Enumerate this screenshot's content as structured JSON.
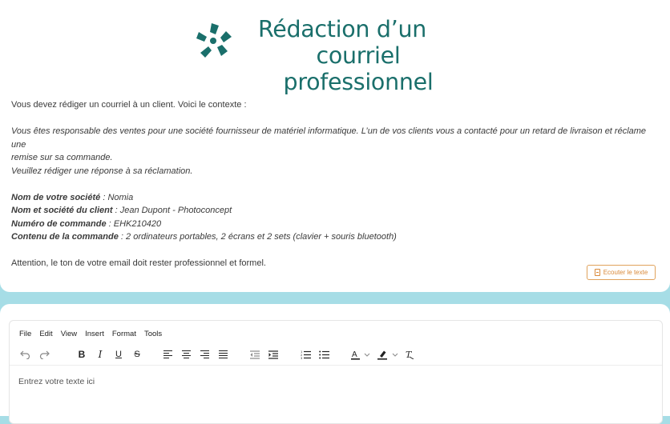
{
  "header": {
    "title_line1": "Rédaction d’un",
    "title_line2": "courriel professionnel",
    "brand_color": "#1a6f6b"
  },
  "instructions": {
    "intro": "Vous devez rédiger un courriel à un client. Voici le contexte :",
    "context_line1": "Vous êtes responsable des ventes pour une société fournisseur de matériel informatique. L’un de vos clients vous a contacté pour un retard de livraison et réclame une",
    "context_line2": "remise sur sa commande.",
    "context_line3": "Veuillez rédiger une réponse à sa réclamation.",
    "facts": [
      {
        "label": "Nom de votre société",
        "value": "Nomia"
      },
      {
        "label": "Nom et société du client",
        "value": "Jean Dupont - Photoconcept"
      },
      {
        "label": "Numéro de commande",
        "value": "EHK210420"
      },
      {
        "label": "Contenu de la commande",
        "value": "2 ordinateurs portables, 2 écrans et 2 sets (clavier + souris bluetooth)"
      }
    ],
    "warning": "Attention, le ton de votre email doit rester professionnel et formel."
  },
  "listen_button": {
    "label": "Ecouter le texte",
    "color": "#d9893a"
  },
  "editor": {
    "menu": [
      "File",
      "Edit",
      "View",
      "Insert",
      "Format",
      "Tools"
    ],
    "toolbar_icons": [
      "undo-icon",
      "redo-icon",
      "bold-icon",
      "italic-icon",
      "underline-icon",
      "strikethrough-icon",
      "align-left-icon",
      "align-center-icon",
      "align-right-icon",
      "align-justify-icon",
      "outdent-icon",
      "indent-icon",
      "numbered-list-icon",
      "bullet-list-icon",
      "text-color-icon",
      "highlight-color-icon",
      "clear-format-icon"
    ],
    "placeholder": "Entrez votre texte ici"
  },
  "colors": {
    "background": "#a6dde6"
  }
}
